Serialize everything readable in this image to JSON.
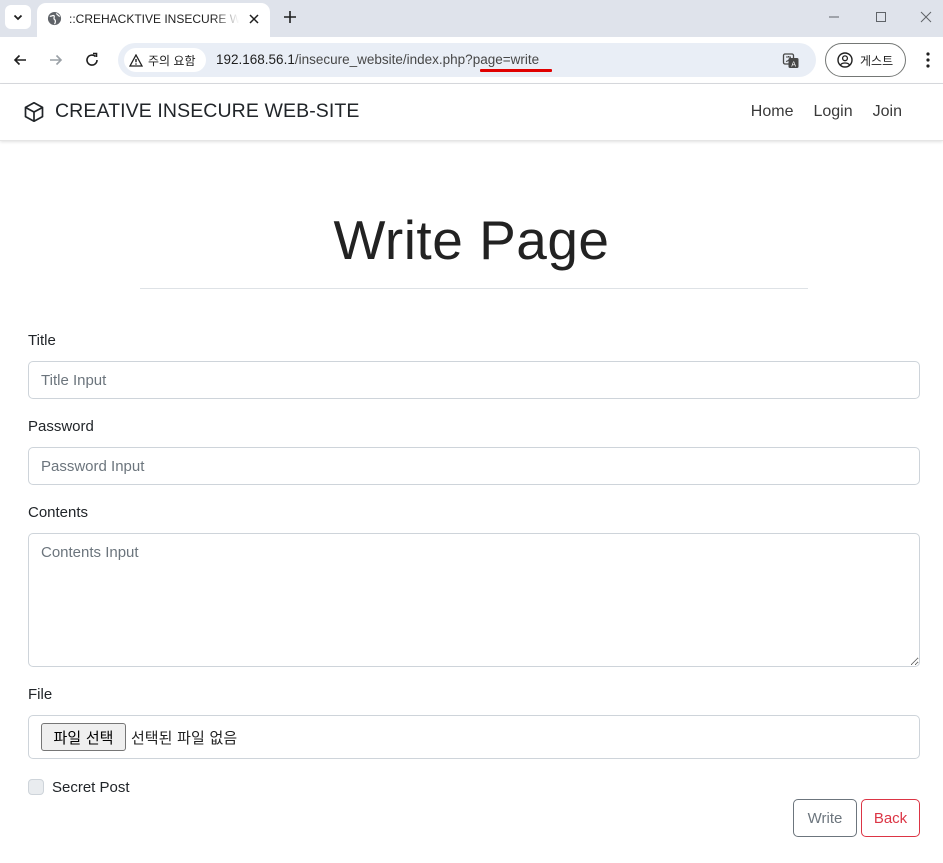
{
  "browser": {
    "tab_title": "::CREHACKTIVE INSECURE WEBSITE::",
    "security_chip": "주의 요함",
    "url_host": "192.168.56.1",
    "url_path": "/insecure_website/index.php?page=write",
    "profile_label": "게스트"
  },
  "site": {
    "brand": "CREATIVE INSECURE WEB-SITE",
    "nav": [
      "Home",
      "Login",
      "Join"
    ]
  },
  "page": {
    "title": "Write Page"
  },
  "form": {
    "title_label": "Title",
    "title_placeholder": "Title Input",
    "password_label": "Password",
    "password_placeholder": "Password Input",
    "contents_label": "Contents",
    "contents_placeholder": "Contents Input",
    "file_label": "File",
    "file_button": "파일 선택",
    "file_status": "선택된 파일 없음",
    "secret_label": "Secret Post",
    "secret_checked": false,
    "write_button": "Write",
    "back_button": "Back"
  },
  "colors": {
    "accent_danger": "#dc3545",
    "secondary": "#6c757d",
    "url_highlight": "#e00000"
  }
}
